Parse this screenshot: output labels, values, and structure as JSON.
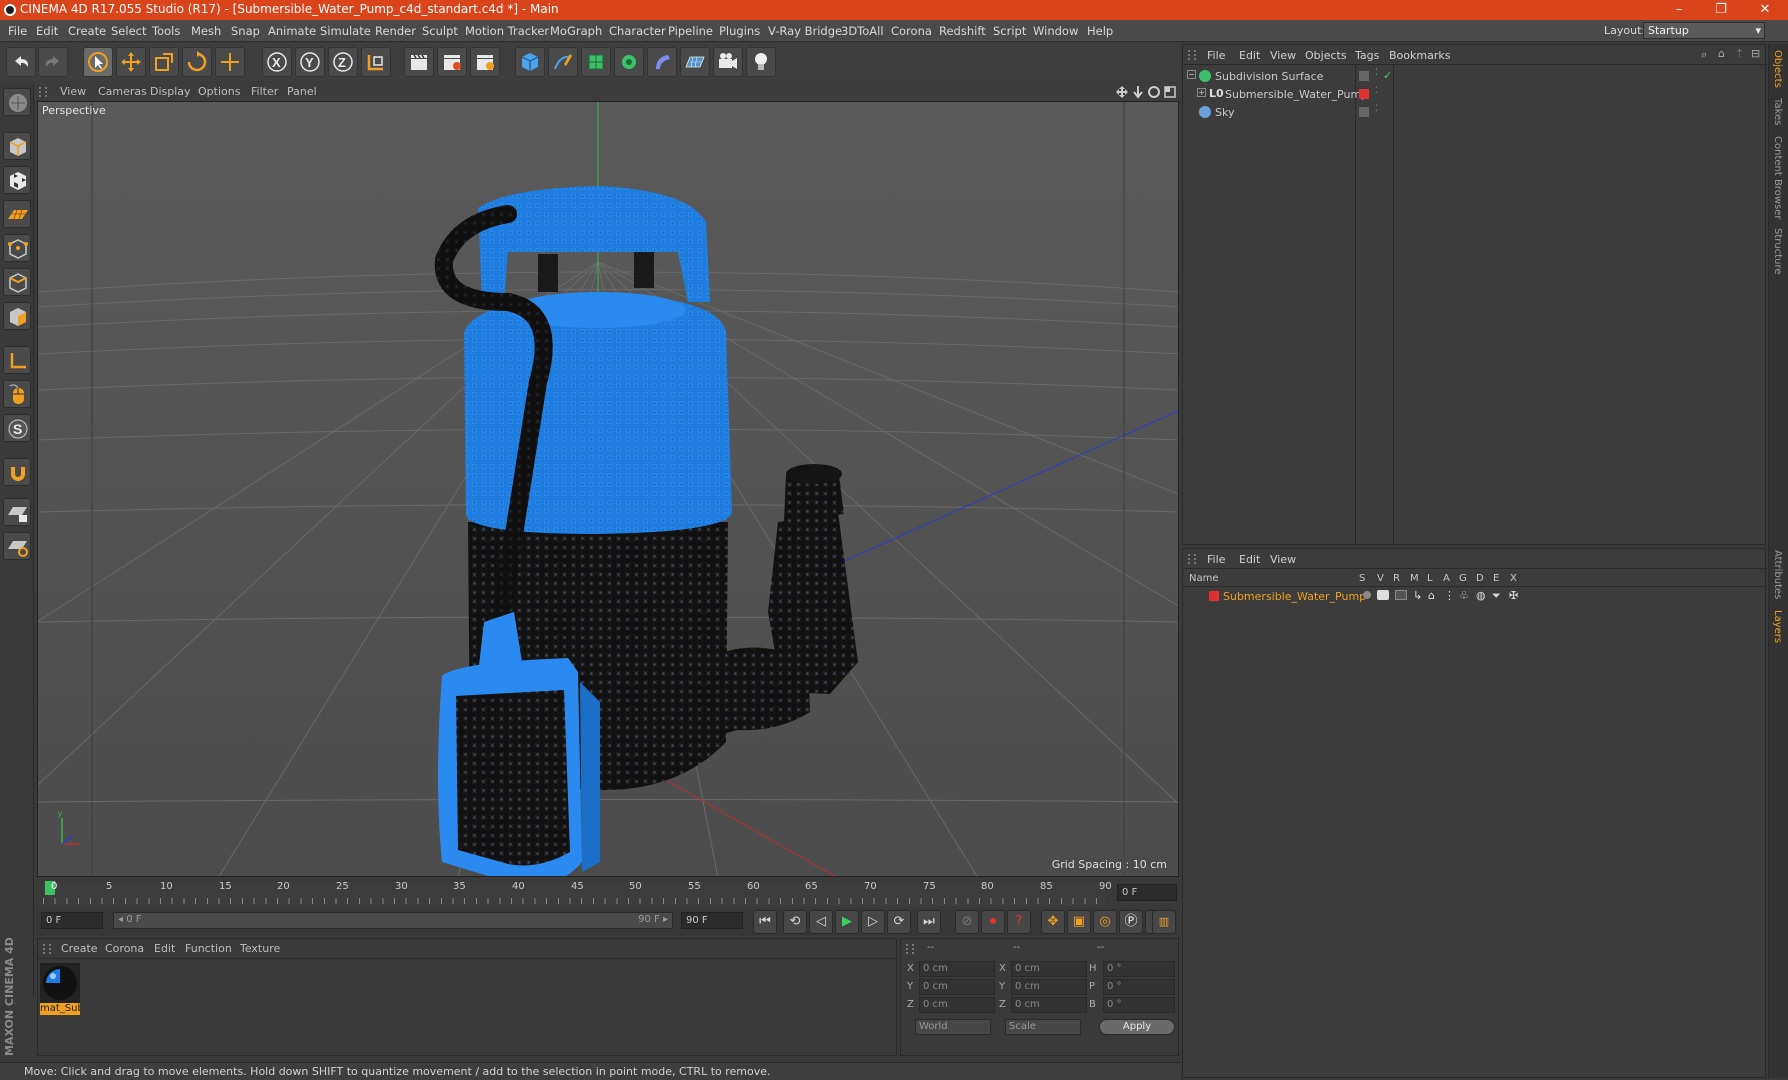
{
  "window": {
    "title": "CINEMA 4D R17.055 Studio (R17) - [Submersible_Water_Pump_c4d_standart.c4d *] - Main",
    "minimize": "–",
    "maximize": "❐",
    "close": "✕"
  },
  "menu": {
    "items": [
      "File",
      "Edit",
      "Create",
      "Select",
      "Tools",
      "Mesh",
      "Snap",
      "Animate",
      "Simulate",
      "Render",
      "Sculpt",
      "Motion Tracker",
      "MoGraph",
      "Character",
      "Pipeline",
      "Plugins",
      "V-Ray Bridge",
      "3DToAll",
      "Corona",
      "Redshift",
      "Script",
      "Window",
      "Help"
    ],
    "layout_label": "Layout:",
    "layout_value": "Startup"
  },
  "toolbar": {
    "axis_x": "X",
    "axis_y": "Y",
    "axis_z": "Z"
  },
  "viewport": {
    "menu": [
      "View",
      "Cameras",
      "Display",
      "Options",
      "Filter",
      "Panel"
    ],
    "label": "Perspective",
    "grid_spacing": "Grid Spacing : 10 cm"
  },
  "timeline": {
    "ticks": [
      "0",
      "5",
      "10",
      "15",
      "20",
      "25",
      "30",
      "35",
      "40",
      "45",
      "50",
      "55",
      "60",
      "65",
      "70",
      "75",
      "80",
      "85",
      "90"
    ],
    "current_frame": "0 F",
    "start_field": "0 F",
    "range_start": "◂ 0 F",
    "range_end": "90 F ▸",
    "end_field": "90 F"
  },
  "material_manager": {
    "menu": [
      "Create",
      "Corona",
      "Edit",
      "Function",
      "Texture"
    ],
    "material_name": "mat_Sub"
  },
  "coordinates": {
    "header": [
      "--",
      "--",
      "--"
    ],
    "rows": [
      {
        "a": "X",
        "av": "0 cm",
        "b": "X",
        "bv": "0 cm",
        "c": "H",
        "cv": "0 °"
      },
      {
        "a": "Y",
        "av": "0 cm",
        "b": "Y",
        "bv": "0 cm",
        "c": "P",
        "cv": "0 °"
      },
      {
        "a": "Z",
        "av": "0 cm",
        "b": "Z",
        "bv": "0 cm",
        "c": "B",
        "cv": "0 °"
      }
    ],
    "mode1": "World",
    "mode2": "Scale",
    "apply": "Apply"
  },
  "object_manager": {
    "menu": [
      "File",
      "Edit",
      "View",
      "Objects",
      "Tags",
      "Bookmarks"
    ],
    "objects": [
      {
        "name": "Subdivision Surface"
      },
      {
        "name": "Submersible_Water_Pump"
      },
      {
        "name": "Sky"
      }
    ]
  },
  "layer_manager": {
    "menu": [
      "File",
      "Edit",
      "View"
    ],
    "col_name": "Name",
    "cols": [
      "S",
      "V",
      "R",
      "M",
      "L",
      "A",
      "G",
      "D",
      "E",
      "X"
    ],
    "layer": "Submersible_Water_Pump"
  },
  "right_tabs": [
    "Objects",
    "Takes",
    "Content Browser",
    "Structure",
    "Attributes",
    "Layers"
  ],
  "status": "Move: Click and drag to move elements. Hold down SHIFT to quantize movement / add to the selection in point mode, CTRL to remove.",
  "brand": "MAXON CINEMA 4D",
  "colors": {
    "title": "#d9441a",
    "accent": "#f0a020",
    "pump_blue": "#1f7de0",
    "layer_red": "#e03030"
  }
}
